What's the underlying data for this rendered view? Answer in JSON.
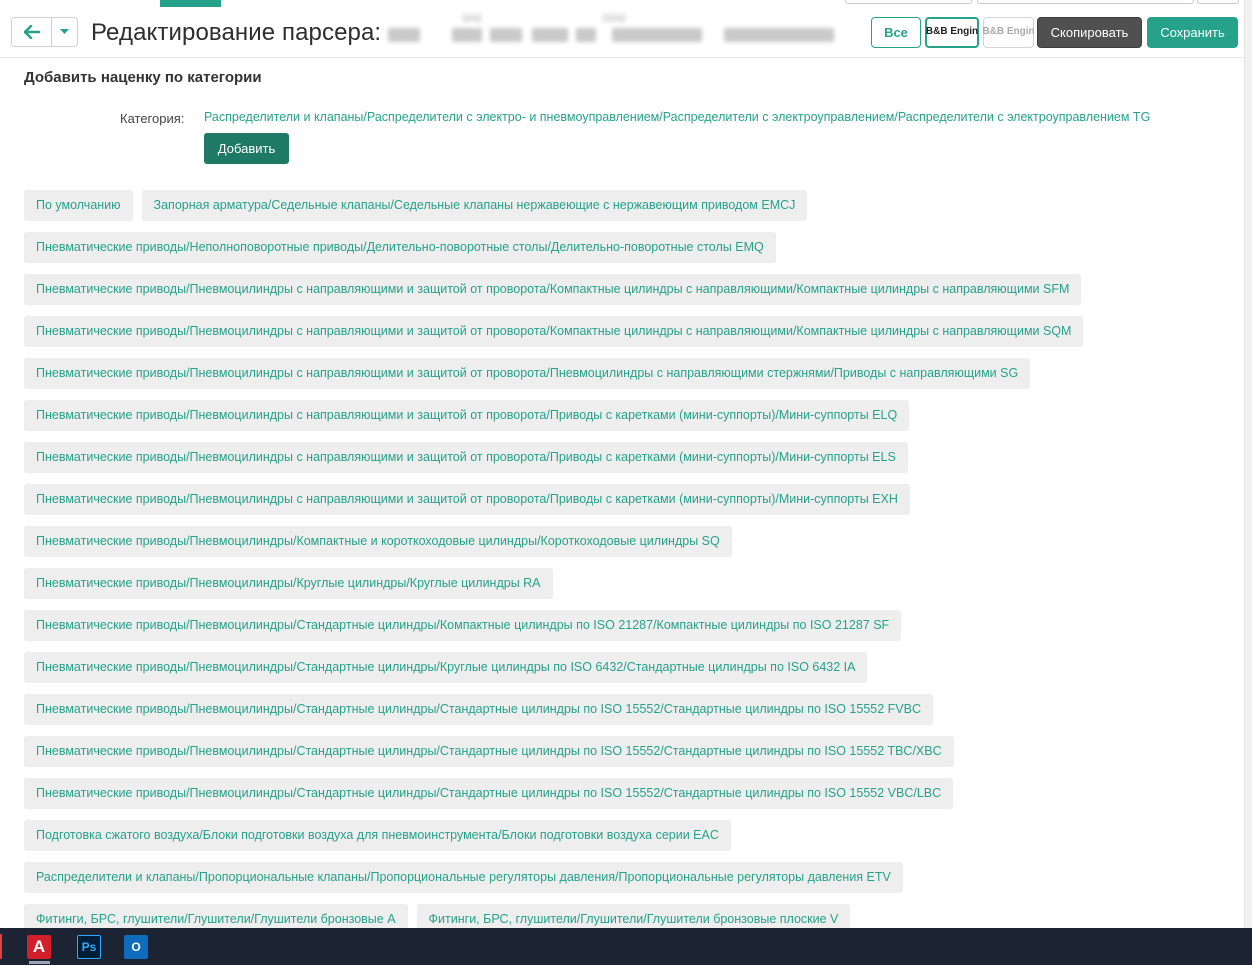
{
  "header": {
    "title": "Редактирование парсера:",
    "buttons": {
      "all": "Все",
      "logo1": "B&B Engin",
      "logo2": "B&B Engin",
      "copy": "Скопировать",
      "save": "Сохранить"
    }
  },
  "section": {
    "title": "Добавить наценку по категории",
    "category_label": "Категория:",
    "category_value": "Распределители и клапаны/Распределители с электро- и пневмоуправлением/Распределители с электроуправлением/Распределители с электроуправлением TG",
    "add_button": "Добавить"
  },
  "tags": [
    [
      "По умолчанию",
      "Запорная арматура/Седельные клапаны/Седельные клапаны нержавеющие с нержавеющим приводом EMCJ"
    ],
    [
      "Пневматические приводы/Неполноповоротные приводы/Делительно-поворотные столы/Делительно-поворотные столы EMQ"
    ],
    [
      "Пневматические приводы/Пневмоцилиндры с направляющими и защитой от проворота/Компактные цилиндры с направляющими/Компактные цилиндры с направляющими SFM"
    ],
    [
      "Пневматические приводы/Пневмоцилиндры с направляющими и защитой от проворота/Компактные цилиндры с направляющими/Компактные цилиндры с направляющими SQM"
    ],
    [
      "Пневматические приводы/Пневмоцилиндры с направляющими и защитой от проворота/Пневмоцилиндры с направляющими стержнями/Приводы с направляющими SG"
    ],
    [
      "Пневматические приводы/Пневмоцилиндры с направляющими и защитой от проворота/Приводы с каретками (мини-суппорты)/Мини-суппорты ELQ"
    ],
    [
      "Пневматические приводы/Пневмоцилиндры с направляющими и защитой от проворота/Приводы с каретками (мини-суппорты)/Мини-суппорты ELS"
    ],
    [
      "Пневматические приводы/Пневмоцилиндры с направляющими и защитой от проворота/Приводы с каретками (мини-суппорты)/Мини-суппорты EXH"
    ],
    [
      "Пневматические приводы/Пневмоцилиндры/Компактные и короткоходовые цилиндры/Короткоходовые цилиндры SQ"
    ],
    [
      "Пневматические приводы/Пневмоцилиндры/Круглые цилиндры/Круглые цилиндры RA"
    ],
    [
      "Пневматические приводы/Пневмоцилиндры/Стандартные цилиндры/Компактные цилиндры по ISO 21287/Компактные цилиндры по ISO 21287 SF"
    ],
    [
      "Пневматические приводы/Пневмоцилиндры/Стандартные цилиндры/Круглые цилиндры по ISO 6432/Стандартные цилиндры по ISO 6432 IA"
    ],
    [
      "Пневматические приводы/Пневмоцилиндры/Стандартные цилиндры/Стандартные цилиндры по ISO 15552/Стандартные цилиндры по ISO 15552 FVBC"
    ],
    [
      "Пневматические приводы/Пневмоцилиндры/Стандартные цилиндры/Стандартные цилиндры по ISO 15552/Стандартные цилиндры по ISO 15552 TBC/XBC"
    ],
    [
      "Пневматические приводы/Пневмоцилиндры/Стандартные цилиндры/Стандартные цилиндры по ISO 15552/Стандартные цилиндры по ISO 15552 VBC/LBC"
    ],
    [
      "Подготовка сжатого воздуха/Блоки подготовки воздуха для пневмоинструмента/Блоки подготовки воздуха серии EAC"
    ],
    [
      "Распределители и клапаны/Пропорциональные клапаны/Пропорциональные регуляторы давления/Пропорциональные регуляторы давления ETV"
    ],
    [
      "Фитинги, БРС, глушители/Глушители/Глушители бронзовые A",
      "Фитинги, БРС, глушители/Глушители/Глушители бронзовые плоские V"
    ]
  ],
  "taskbar": {
    "autocad_glyph": "A",
    "photoshop_glyph": "Ps",
    "outlook_glyph": "O"
  },
  "colors": {
    "accent": "#26a28b",
    "add_button": "#1f7a65",
    "copy_button": "#505050",
    "tag_bg": "#eeeeee",
    "taskbar": "#1c2434"
  }
}
